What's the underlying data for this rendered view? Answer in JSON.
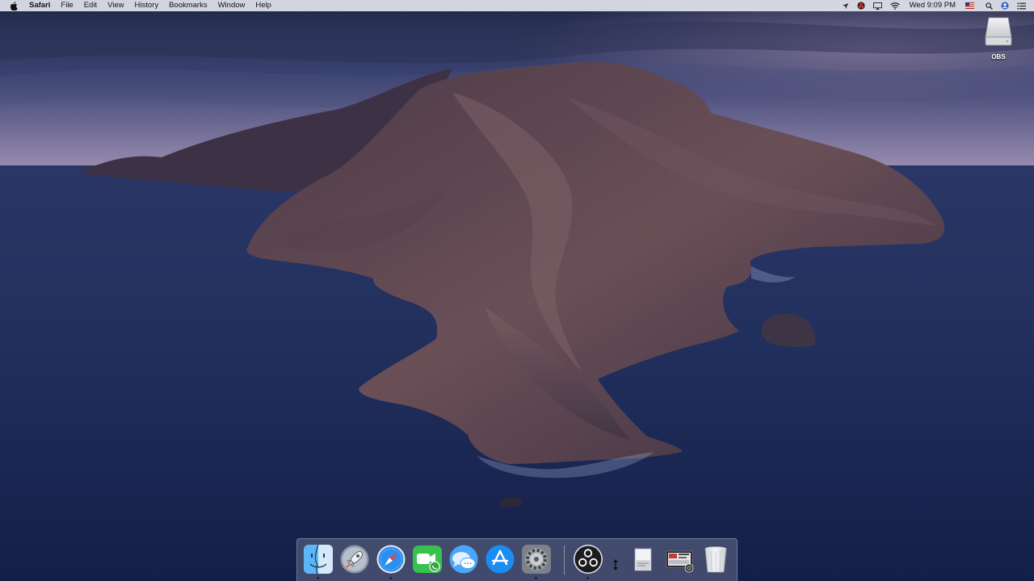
{
  "menubar": {
    "app_name": "Safari",
    "menus": [
      "File",
      "Edit",
      "View",
      "History",
      "Bookmarks",
      "Window",
      "Help"
    ],
    "clock": "Wed 9:09 PM",
    "status_icons": [
      "location-arrow-icon",
      "obs-status-icon",
      "airplay-icon",
      "wifi-icon",
      "us-flag-icon",
      "search-icon",
      "user-icon",
      "notification-center-icon"
    ]
  },
  "desktop": {
    "drive_label": "OBS"
  },
  "dock": {
    "items": [
      {
        "name": "finder-icon",
        "running": true
      },
      {
        "name": "launchpad-icon",
        "running": false
      },
      {
        "name": "safari-icon",
        "running": true
      },
      {
        "name": "facetime-icon",
        "running": false
      },
      {
        "name": "messages-icon",
        "running": false
      },
      {
        "name": "app-store-icon",
        "running": false
      },
      {
        "name": "system-preferences-icon",
        "running": true
      },
      {
        "name": "obs-icon",
        "running": true
      },
      {
        "name": "downloads-icon",
        "running": false
      },
      {
        "name": "document-stack-icon",
        "running": false
      },
      {
        "name": "screenshot-stack-icon",
        "running": false
      },
      {
        "name": "trash-icon",
        "running": false
      }
    ]
  },
  "colors": {
    "menubar_bg": "#e2e4ee",
    "sky_top": "#2b3356",
    "sky_horizon": "#8a86ad",
    "ocean": "#1b2a55",
    "island": "#5a4550",
    "dock_bg": "#787e96"
  }
}
